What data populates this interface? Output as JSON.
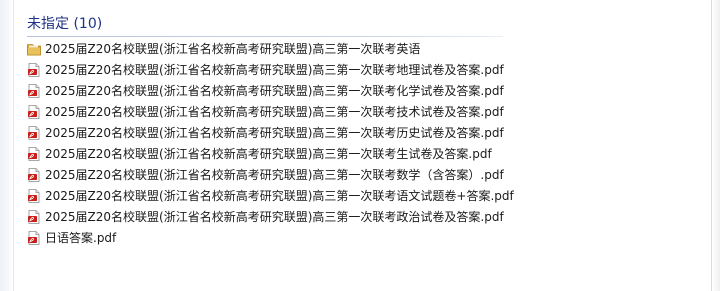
{
  "group": {
    "title": "未指定 (10)"
  },
  "files": [
    {
      "type": "folder",
      "icon": "folder-icon",
      "name": "2025届Z20名校联盟(浙江省名校新高考研究联盟)高三第一次联考英语"
    },
    {
      "type": "pdf",
      "icon": "pdf-file-icon",
      "name": "2025届Z20名校联盟(浙江省名校新高考研究联盟)高三第一次联考地理试卷及答案.pdf"
    },
    {
      "type": "pdf",
      "icon": "pdf-file-icon",
      "name": "2025届Z20名校联盟(浙江省名校新高考研究联盟)高三第一次联考化学试卷及答案.pdf"
    },
    {
      "type": "pdf",
      "icon": "pdf-file-icon",
      "name": "2025届Z20名校联盟(浙江省名校新高考研究联盟)高三第一次联考技术试卷及答案.pdf"
    },
    {
      "type": "pdf",
      "icon": "pdf-file-icon",
      "name": "2025届Z20名校联盟(浙江省名校新高考研究联盟)高三第一次联考历史试卷及答案.pdf"
    },
    {
      "type": "pdf",
      "icon": "pdf-file-icon",
      "name": "2025届Z20名校联盟(浙江省名校新高考研究联盟)高三第一次联考生试卷及答案.pdf"
    },
    {
      "type": "pdf",
      "icon": "pdf-file-icon",
      "name": "2025届Z20名校联盟(浙江省名校新高考研究联盟)高三第一次联考数学（含答案）.pdf"
    },
    {
      "type": "pdf",
      "icon": "pdf-file-icon",
      "name": "2025届Z20名校联盟(浙江省名校新高考研究联盟)高三第一次联考语文试题卷+答案.pdf"
    },
    {
      "type": "pdf",
      "icon": "pdf-file-icon",
      "name": "2025届Z20名校联盟(浙江省名校新高考研究联盟)高三第一次联考政治试卷及答案.pdf"
    },
    {
      "type": "pdf",
      "icon": "pdf-file-icon",
      "name": "日语答案.pdf"
    }
  ],
  "colors": {
    "group_title": "#1e3287",
    "pdf_red": "#c8201a",
    "folder_yellow": "#e8c15a"
  }
}
